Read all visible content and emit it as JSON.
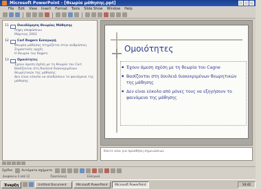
{
  "window": {
    "title": "Microsoft PowerPoint - [Θεωρία μάθησης.ppt]"
  },
  "menu": [
    "File",
    "Edit",
    "View",
    "Insert",
    "Format",
    "Tools",
    "Slide Show",
    "Window",
    "Help"
  ],
  "outline": {
    "slides": [
      {
        "num": "11",
        "title": "Οικοδόμηση Θεωρίας Μάθησης",
        "sub": [
          "Λήψη αποφάσεων",
          "Μάρτιος 2002"
        ]
      },
      {
        "num": "12",
        "title": "Carl Rogers Εισαγωγή",
        "bullets": [
          "Θεωρία μάθησης στηρίζεται στην ανθρώπινη",
          "Σημαντικές αρχές",
          "Η θεωρία του Rogers"
        ]
      },
      {
        "num": "13",
        "title": "Ομοιότητες",
        "bullets": [
          "Έχουν άμεση σχέση με τη θεωρία του Carl",
          "Βασίζονται στη δουλειά διακεκριμένων θεωρητικών της μάθησης",
          "Δεν είναι εύκολο να αποδώσουν το φαινόμενο της μάθησης"
        ]
      }
    ]
  },
  "slide": {
    "title": "Ομοιότητες",
    "bullets": [
      "Έχουν άμεση σχέση με τη θεωρία του Cagne",
      "Βασίζονται στη δουλειά διακεκριμένων θεωρητικών της μάθησης",
      "Δεν είναι εύκολο από μόνες τους να εξηγήσουν το φαινόμενο της μάθησης"
    ]
  },
  "notes": {
    "placeholder": "Κάντε κλικ για προσθήκη σημειώσεων"
  },
  "drawbar": {
    "draw_label": "Σχέδιο",
    "autoshapes_label": "Αυτόματα σχήματα"
  },
  "status": {
    "slide": "Διαφάνεια 3 από 12",
    "design": "Προεπιλογή",
    "language": "Ελληνικά"
  },
  "taskbar": {
    "start": "Έναρξη",
    "tasks": [
      "Untitled Document",
      "Microsoft PowerPoint",
      "Microsoft PowerPoint"
    ],
    "clock": "10:42"
  }
}
